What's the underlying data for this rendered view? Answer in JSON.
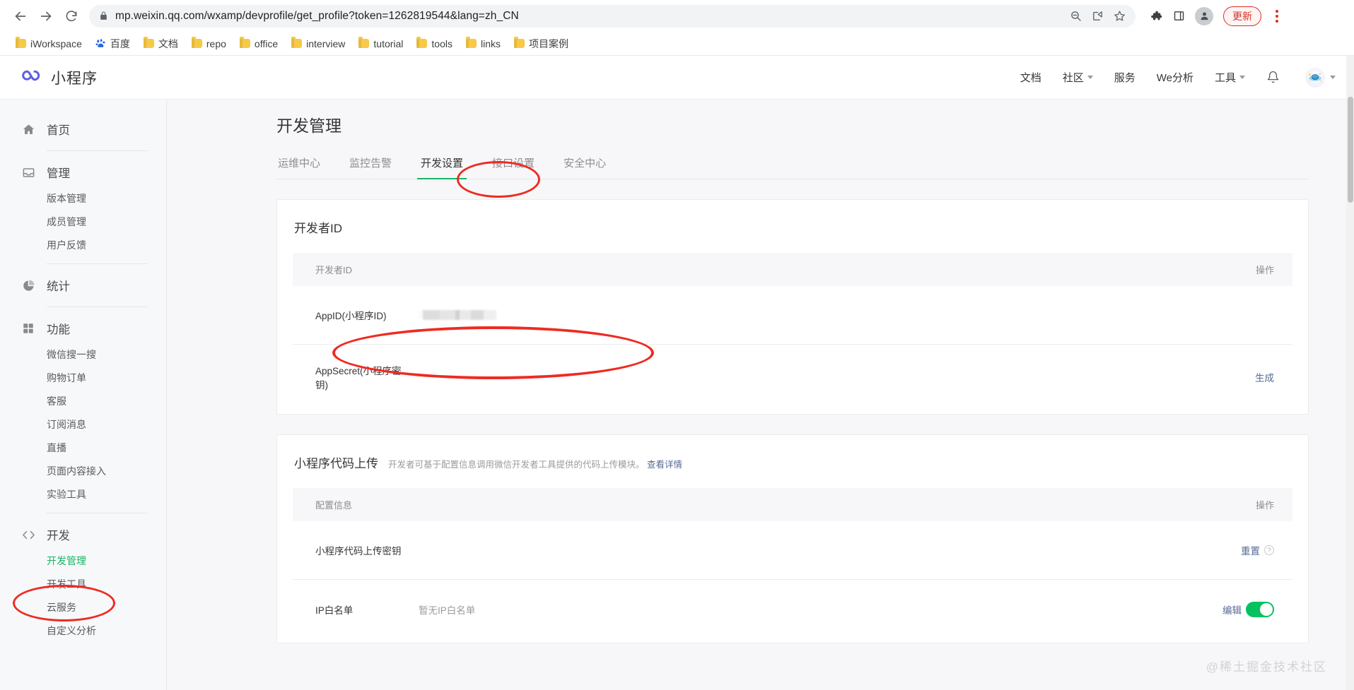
{
  "browser": {
    "url": "mp.weixin.qq.com/wxamp/devprofile/get_profile?token=1262819544&lang=zh_CN",
    "update_button": "更新",
    "bookmarks": [
      {
        "label": "iWorkspace",
        "icon": "folder-icon"
      },
      {
        "label": "百度",
        "icon": "baidu-icon"
      },
      {
        "label": "文档",
        "icon": "folder-icon"
      },
      {
        "label": "repo",
        "icon": "folder-icon"
      },
      {
        "label": "office",
        "icon": "folder-icon"
      },
      {
        "label": "interview",
        "icon": "folder-icon"
      },
      {
        "label": "tutorial",
        "icon": "folder-icon"
      },
      {
        "label": "tools",
        "icon": "folder-icon"
      },
      {
        "label": "links",
        "icon": "folder-icon"
      },
      {
        "label": "项目案例",
        "icon": "folder-icon"
      }
    ]
  },
  "header": {
    "brand": "小程序",
    "nav": [
      {
        "label": "文档",
        "caret": false
      },
      {
        "label": "社区",
        "caret": true
      },
      {
        "label": "服务",
        "caret": false
      },
      {
        "label": "We分析",
        "caret": false
      },
      {
        "label": "工具",
        "caret": true
      }
    ]
  },
  "sidebar": {
    "groups": [
      {
        "icon": "home-icon",
        "label": "首页",
        "items": []
      },
      {
        "icon": "inbox-icon",
        "label": "管理",
        "items": [
          {
            "label": "版本管理",
            "active": false
          },
          {
            "label": "成员管理",
            "active": false
          },
          {
            "label": "用户反馈",
            "active": false
          }
        ]
      },
      {
        "icon": "chart-pie-icon",
        "label": "统计",
        "items": []
      },
      {
        "icon": "grid-icon",
        "label": "功能",
        "items": [
          {
            "label": "微信搜一搜",
            "active": false
          },
          {
            "label": "购物订单",
            "active": false
          },
          {
            "label": "客服",
            "active": false
          },
          {
            "label": "订阅消息",
            "active": false
          },
          {
            "label": "直播",
            "active": false
          },
          {
            "label": "页面内容接入",
            "active": false
          },
          {
            "label": "实验工具",
            "active": false
          }
        ]
      },
      {
        "icon": "code-icon",
        "label": "开发",
        "items": [
          {
            "label": "开发管理",
            "active": true
          },
          {
            "label": "开发工具",
            "active": false
          },
          {
            "label": "云服务",
            "active": false
          },
          {
            "label": "自定义分析",
            "active": false
          }
        ]
      }
    ]
  },
  "main": {
    "page_title": "开发管理",
    "tabs": [
      {
        "label": "运维中心",
        "active": false
      },
      {
        "label": "监控告警",
        "active": false
      },
      {
        "label": "开发设置",
        "active": true
      },
      {
        "label": "接口设置",
        "active": false
      },
      {
        "label": "安全中心",
        "active": false
      }
    ],
    "cards": [
      {
        "title": "开发者ID",
        "desc": "",
        "desc_link": "",
        "columns": {
          "label": "开发者ID",
          "action": "操作"
        },
        "rows": [
          {
            "name": "AppID(小程序ID)",
            "value": "",
            "redacted": true,
            "action": "",
            "help": false,
            "toggle": false
          },
          {
            "name": "AppSecret(小程序密钥)",
            "value": "",
            "redacted": false,
            "action": "生成",
            "help": false,
            "toggle": false
          }
        ]
      },
      {
        "title": "小程序代码上传",
        "desc": "开发者可基于配置信息调用微信开发者工具提供的代码上传模块。",
        "desc_link": "查看详情",
        "columns": {
          "label": "配置信息",
          "action": "操作"
        },
        "rows": [
          {
            "name": "小程序代码上传密钥",
            "value": "",
            "redacted": false,
            "action": "重置",
            "help": true,
            "toggle": false
          },
          {
            "name": "IP白名单",
            "value": "暂无IP白名单",
            "redacted": false,
            "action": "编辑",
            "help": false,
            "toggle": true
          }
        ]
      }
    ]
  },
  "watermark": "@稀土掘金技术社区",
  "colors": {
    "accent_green": "#18b566",
    "toggle_green": "#07c160",
    "link_blue": "#576b95",
    "annotation_red": "#ee2b22",
    "update_red": "#d93025"
  }
}
